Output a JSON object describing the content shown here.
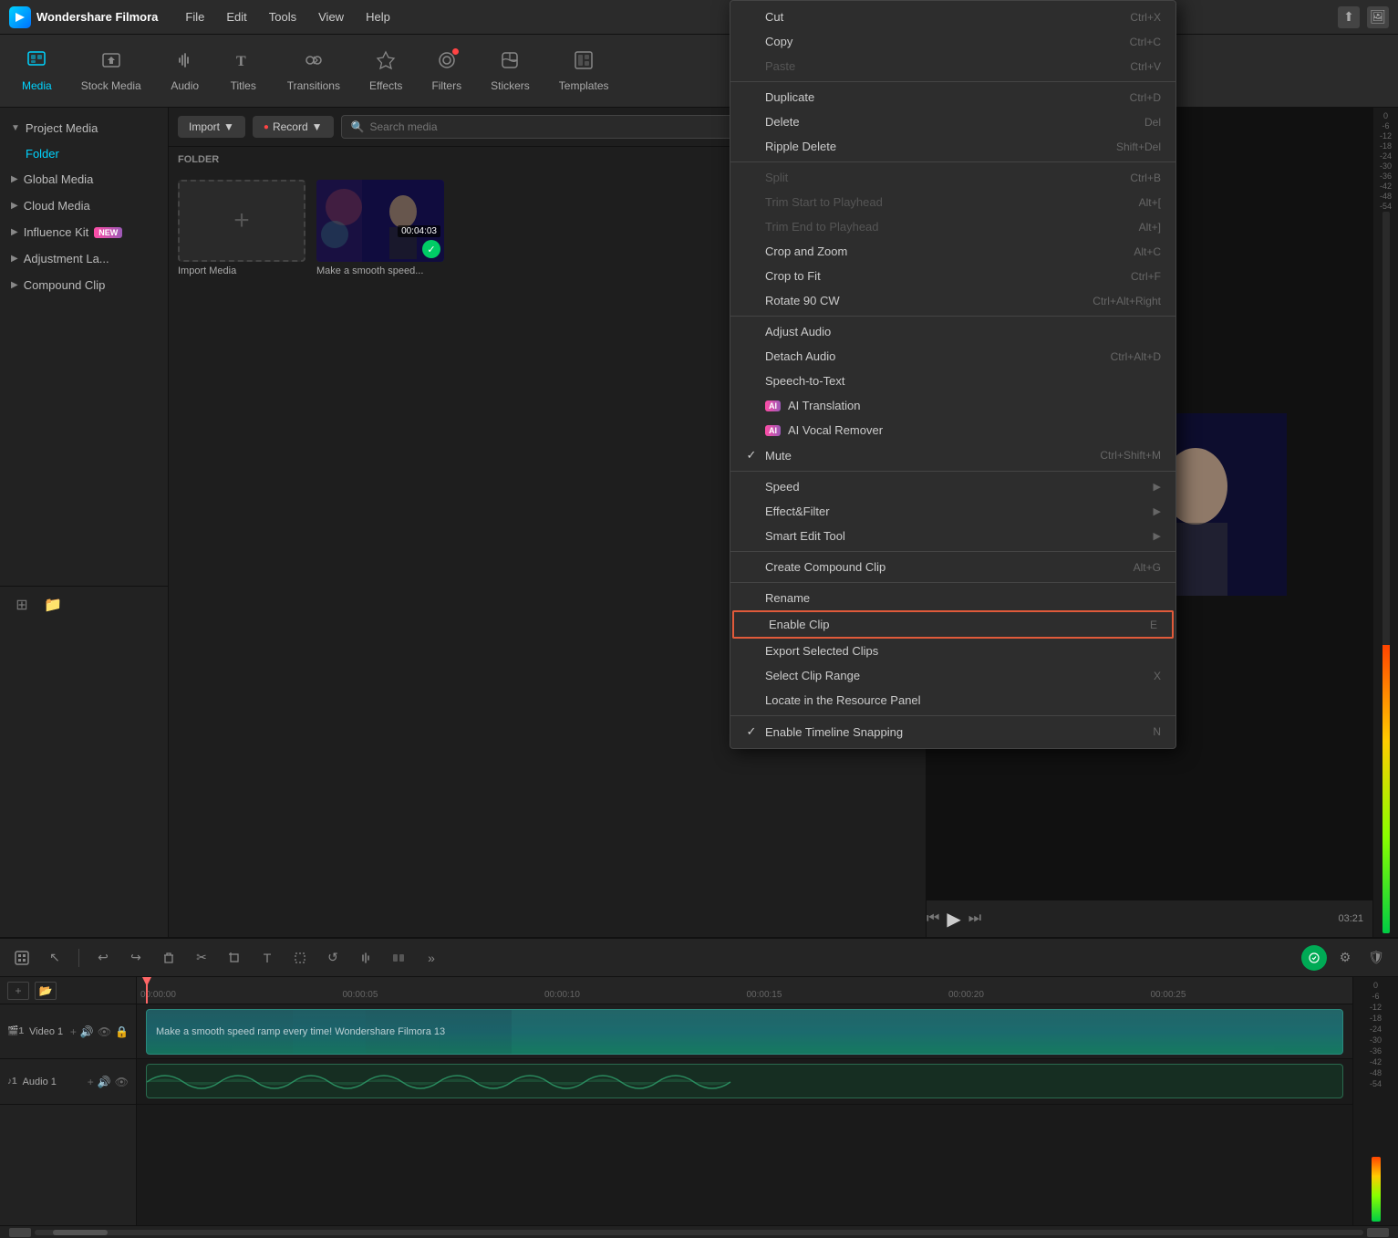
{
  "app": {
    "name": "Wondershare Filmora",
    "logo_letter": "F"
  },
  "menu": {
    "items": [
      "File",
      "Edit",
      "Tools",
      "View",
      "Help"
    ]
  },
  "toolbar": {
    "tabs": [
      {
        "id": "media",
        "label": "Media",
        "icon": "⊞",
        "active": true
      },
      {
        "id": "stock_media",
        "label": "Stock Media",
        "icon": "🎞"
      },
      {
        "id": "audio",
        "label": "Audio",
        "icon": "♪"
      },
      {
        "id": "titles",
        "label": "Titles",
        "icon": "T"
      },
      {
        "id": "transitions",
        "label": "Transitions",
        "icon": "↔"
      },
      {
        "id": "effects",
        "label": "Effects",
        "icon": "✦"
      },
      {
        "id": "filters",
        "label": "Filters",
        "icon": "◉",
        "has_dot": true
      },
      {
        "id": "stickers",
        "label": "Stickers",
        "icon": "◈"
      },
      {
        "id": "templates",
        "label": "Templates",
        "icon": "⊡"
      }
    ]
  },
  "sidebar": {
    "sections": [
      {
        "id": "project_media",
        "label": "Project Media",
        "expanded": true
      },
      {
        "id": "folder",
        "label": "Folder",
        "indent": true
      },
      {
        "id": "global_media",
        "label": "Global Media"
      },
      {
        "id": "cloud_media",
        "label": "Cloud Media"
      },
      {
        "id": "influence_kit",
        "label": "Influence Kit",
        "badge": "NEW"
      },
      {
        "id": "adjustment_layer",
        "label": "Adjustment La..."
      },
      {
        "id": "compound_clip",
        "label": "Compound Clip"
      }
    ]
  },
  "media_panel": {
    "import_label": "Import",
    "record_label": "Record",
    "search_placeholder": "Search media",
    "folder_label": "FOLDER",
    "items": [
      {
        "id": "import",
        "type": "add",
        "name": "Import Media"
      },
      {
        "id": "clip1",
        "type": "video",
        "name": "Make a smooth speed...",
        "duration": "00:04:03",
        "checked": true
      }
    ]
  },
  "timeline": {
    "toolbar_buttons": [
      {
        "id": "snap",
        "icon": "⊞",
        "active": false
      },
      {
        "id": "select",
        "icon": "↖",
        "active": false
      },
      {
        "id": "undo",
        "icon": "↩"
      },
      {
        "id": "redo",
        "icon": "↪"
      },
      {
        "id": "delete",
        "icon": "🗑"
      },
      {
        "id": "cut",
        "icon": "✂"
      },
      {
        "id": "crop",
        "icon": "⊡"
      },
      {
        "id": "text",
        "icon": "T"
      },
      {
        "id": "transform",
        "icon": "⊞"
      },
      {
        "id": "rotate",
        "icon": "↺"
      },
      {
        "id": "ai_audio",
        "icon": "♬"
      },
      {
        "id": "transition",
        "icon": "⊡"
      },
      {
        "id": "more",
        "icon": "»"
      }
    ],
    "ruler": {
      "marks": [
        "00:00:00",
        "00:00:05",
        "00:00:10",
        "00:00:15",
        "00:00:20",
        "00:00:25"
      ]
    },
    "tracks": [
      {
        "id": "video1",
        "label": "Video 1",
        "type": "video",
        "clip_label": "Make a smooth speed ramp every time! Wondershare Filmora 13"
      },
      {
        "id": "audio1",
        "label": "Audio 1",
        "type": "audio"
      }
    ],
    "time_display": "03:21"
  },
  "context_menu": {
    "items": [
      {
        "id": "cut",
        "label": "Cut",
        "shortcut": "Ctrl+X",
        "disabled": false
      },
      {
        "id": "copy",
        "label": "Copy",
        "shortcut": "Ctrl+C",
        "disabled": false
      },
      {
        "id": "paste",
        "label": "Paste",
        "shortcut": "Ctrl+V",
        "disabled": true
      },
      {
        "separator": true
      },
      {
        "id": "duplicate",
        "label": "Duplicate",
        "shortcut": "Ctrl+D",
        "disabled": false
      },
      {
        "id": "delete",
        "label": "Delete",
        "shortcut": "Del",
        "disabled": false
      },
      {
        "id": "ripple_delete",
        "label": "Ripple Delete",
        "shortcut": "Shift+Del",
        "disabled": false
      },
      {
        "separator": true
      },
      {
        "id": "split",
        "label": "Split",
        "shortcut": "Ctrl+B",
        "disabled": true
      },
      {
        "id": "trim_start",
        "label": "Trim Start to Playhead",
        "shortcut": "Alt+[",
        "disabled": true
      },
      {
        "id": "trim_end",
        "label": "Trim End to Playhead",
        "shortcut": "Alt+]",
        "disabled": true
      },
      {
        "id": "crop_zoom",
        "label": "Crop and Zoom",
        "shortcut": "Alt+C",
        "disabled": false
      },
      {
        "id": "crop_fit",
        "label": "Crop to Fit",
        "shortcut": "Ctrl+F",
        "disabled": false
      },
      {
        "id": "rotate",
        "label": "Rotate 90 CW",
        "shortcut": "Ctrl+Alt+Right",
        "disabled": false
      },
      {
        "separator": true
      },
      {
        "id": "adjust_audio",
        "label": "Adjust Audio",
        "disabled": false
      },
      {
        "id": "detach_audio",
        "label": "Detach Audio",
        "shortcut": "Ctrl+Alt+D",
        "disabled": false
      },
      {
        "id": "speech_to_text",
        "label": "Speech-to-Text",
        "disabled": false
      },
      {
        "id": "ai_translation",
        "label": "AI Translation",
        "badge": "AI",
        "disabled": false
      },
      {
        "id": "ai_vocal_remover",
        "label": "AI Vocal Remover",
        "badge": "AI",
        "disabled": false
      },
      {
        "id": "mute",
        "label": "Mute",
        "shortcut": "Ctrl+Shift+M",
        "disabled": false,
        "checked": true
      },
      {
        "separator": true
      },
      {
        "id": "speed",
        "label": "Speed",
        "has_arrow": true,
        "disabled": false
      },
      {
        "id": "effect_filter",
        "label": "Effect&Filter",
        "has_arrow": true,
        "disabled": false
      },
      {
        "id": "smart_edit_tool",
        "label": "Smart Edit Tool",
        "has_arrow": true,
        "disabled": false
      },
      {
        "separator": true
      },
      {
        "id": "create_compound",
        "label": "Create Compound Clip",
        "shortcut": "Alt+G",
        "disabled": false
      },
      {
        "separator": true
      },
      {
        "id": "rename",
        "label": "Rename",
        "disabled": false
      },
      {
        "id": "enable_clip",
        "label": "Enable Clip",
        "shortcut": "E",
        "disabled": false,
        "highlighted": true
      },
      {
        "id": "export_selected",
        "label": "Export Selected Clips",
        "disabled": false
      },
      {
        "id": "select_clip_range",
        "label": "Select Clip Range",
        "shortcut": "X",
        "disabled": false
      },
      {
        "id": "locate_resource",
        "label": "Locate in the Resource Panel",
        "disabled": false
      },
      {
        "separator": true
      },
      {
        "id": "enable_snapping",
        "label": "Enable Timeline Snapping",
        "shortcut": "N",
        "disabled": false,
        "checked": true
      }
    ]
  },
  "volume_meter": {
    "labels": [
      "0",
      "-6",
      "-12",
      "-18",
      "-24",
      "-30",
      "-36",
      "-42",
      "-48",
      "-54"
    ]
  }
}
